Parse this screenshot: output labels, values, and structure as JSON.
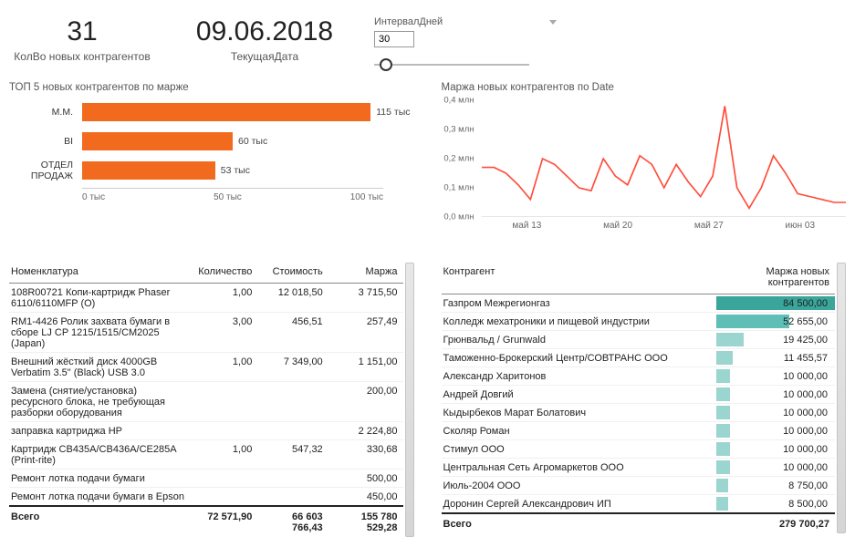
{
  "cards": {
    "count": {
      "value": "31",
      "label": "КолВо новых контрагентов"
    },
    "date": {
      "value": "09.06.2018",
      "label": "ТекущаяДата"
    }
  },
  "slicer": {
    "label": "ИнтервалДней",
    "value": "30"
  },
  "bar_chart_title": "ТОП 5 новых контрагентов по марже",
  "line_chart_title": "Маржа новых контрагентов по Date",
  "chart_data": [
    {
      "type": "bar",
      "orientation": "horizontal",
      "title": "ТОП 5 новых контрагентов по марже",
      "categories": [
        "М.М.",
        "BI",
        "ОТДЕЛ ПРОДАЖ"
      ],
      "values": [
        115,
        60,
        53
      ],
      "value_labels": [
        "115 тыс",
        "60 тыс",
        "53 тыс"
      ],
      "xlim": [
        0,
        120
      ],
      "x_ticks": [
        "0 тыс",
        "50 тыс",
        "100 тыс"
      ],
      "series_color": "#f26a1e"
    },
    {
      "type": "line",
      "title": "Маржа новых контрагентов по Date",
      "ylabel": "млн",
      "ylim": [
        0.0,
        0.4
      ],
      "y_ticks": [
        "0,0 млн",
        "0,1 млн",
        "0,2 млн",
        "0,3 млн",
        "0,4 млн"
      ],
      "x_tick_labels": [
        "май 13",
        "май 20",
        "май 27",
        "июн 03"
      ],
      "x": [
        0,
        1,
        2,
        3,
        4,
        5,
        6,
        7,
        8,
        9,
        10,
        11,
        12,
        13,
        14,
        15,
        16,
        17,
        18,
        19,
        20,
        21,
        22,
        23,
        24,
        25,
        26,
        27,
        28,
        29,
        30
      ],
      "values": [
        0.17,
        0.17,
        0.15,
        0.11,
        0.06,
        0.2,
        0.18,
        0.14,
        0.1,
        0.09,
        0.2,
        0.14,
        0.11,
        0.21,
        0.18,
        0.1,
        0.18,
        0.12,
        0.07,
        0.14,
        0.38,
        0.1,
        0.03,
        0.1,
        0.21,
        0.15,
        0.08,
        0.07,
        0.06,
        0.05,
        0.05
      ],
      "series_color": "#ff4d3a"
    }
  ],
  "table1": {
    "headers": [
      "Номенклатура",
      "Количество",
      "Стоимость",
      "Маржа"
    ],
    "rows": [
      {
        "name": "108R00721 Копи-картридж Phaser 6110/6110MFP (O)",
        "qty": "1,00",
        "cost": "12 018,50",
        "margin": "3 715,50"
      },
      {
        "name": "RM1-4426 Ролик захвата бумаги в сборе LJ CP 1215/1515/CM2025 (Japan)",
        "qty": "3,00",
        "cost": "456,51",
        "margin": "257,49"
      },
      {
        "name": "Внешний жёсткий диск 4000GB Verbatim 3.5\" (Black) USB 3.0",
        "qty": "1,00",
        "cost": "7 349,00",
        "margin": "1 151,00"
      },
      {
        "name": "Замена (снятие/установка) ресурсного блока, не требующая разборки оборудования",
        "qty": "",
        "cost": "",
        "margin": "200,00"
      },
      {
        "name": "заправка картриджа HP",
        "qty": "",
        "cost": "",
        "margin": "2 224,80"
      },
      {
        "name": "Картридж CB435A/CB436A/CE285A (Print-rite)",
        "qty": "1,00",
        "cost": "547,32",
        "margin": "330,68"
      },
      {
        "name": "Ремонт лотка подачи бумаги",
        "qty": "",
        "cost": "",
        "margin": "500,00"
      },
      {
        "name": "Ремонт лотка подачи бумаги в Epson",
        "qty": "",
        "cost": "",
        "margin": "450,00"
      }
    ],
    "footer": {
      "label": "Всего",
      "qty": "72 571,90",
      "cost": "66 603 766,43",
      "margin": "155 780 529,28"
    }
  },
  "table2": {
    "headers": [
      "Контрагент",
      "Маржа новых контрагентов"
    ],
    "rows": [
      {
        "name": "Газпром Межрегионгаз",
        "val": "84 500,00",
        "pct": 100,
        "cls": "top1"
      },
      {
        "name": "Колледж мехатроники и пищевой индустрии",
        "val": "52 655,00",
        "pct": 62,
        "cls": "top2"
      },
      {
        "name": "Грюнвальд / Grunwald",
        "val": "19 425,00",
        "pct": 23,
        "cls": ""
      },
      {
        "name": "Таможенно-Брокерский Центр/СОВТРАНС ООО",
        "val": "11 455,57",
        "pct": 14,
        "cls": ""
      },
      {
        "name": "Александр Харитонов",
        "val": "10 000,00",
        "pct": 12,
        "cls": ""
      },
      {
        "name": "Андрей Довгий",
        "val": "10 000,00",
        "pct": 12,
        "cls": ""
      },
      {
        "name": "Кыдырбеков Марат Болатович",
        "val": "10 000,00",
        "pct": 12,
        "cls": ""
      },
      {
        "name": "Сколяр Роман",
        "val": "10 000,00",
        "pct": 12,
        "cls": ""
      },
      {
        "name": "Стимул ООО",
        "val": "10 000,00",
        "pct": 12,
        "cls": ""
      },
      {
        "name": "Центральная Сеть Агромаркетов ООО",
        "val": "10 000,00",
        "pct": 12,
        "cls": ""
      },
      {
        "name": "Июль-2004 ООО",
        "val": "8 750,00",
        "pct": 10,
        "cls": ""
      },
      {
        "name": "Доронин Сергей Александрович ИП",
        "val": "8 500,00",
        "pct": 10,
        "cls": ""
      }
    ],
    "footer": {
      "label": "Всего",
      "val": "279 700,27"
    }
  }
}
